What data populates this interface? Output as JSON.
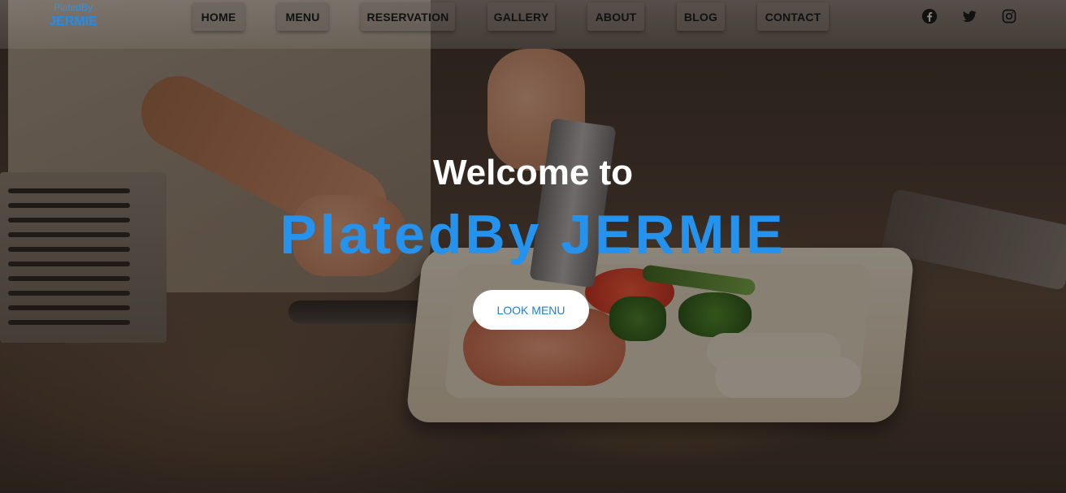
{
  "brand": {
    "small": "PlatedBy",
    "big": "JERMIE"
  },
  "nav": {
    "items": [
      {
        "label": "HOME"
      },
      {
        "label": "MENU"
      },
      {
        "label": "RESERVATION"
      },
      {
        "label": "GALLERY"
      },
      {
        "label": "ABOUT"
      },
      {
        "label": "BLOG"
      },
      {
        "label": "CONTACT"
      }
    ]
  },
  "social": [
    {
      "icon": "facebook-icon"
    },
    {
      "icon": "twitter-icon"
    },
    {
      "icon": "instagram-icon"
    }
  ],
  "hero": {
    "welcome": "Welcome to",
    "title": "PlatedBy JERMIE",
    "cta_label": "LOOK MENU",
    "title_color": "#2593ee"
  },
  "colors": {
    "accent": "#1e8ef0",
    "cta_bg": "#ffffff"
  }
}
